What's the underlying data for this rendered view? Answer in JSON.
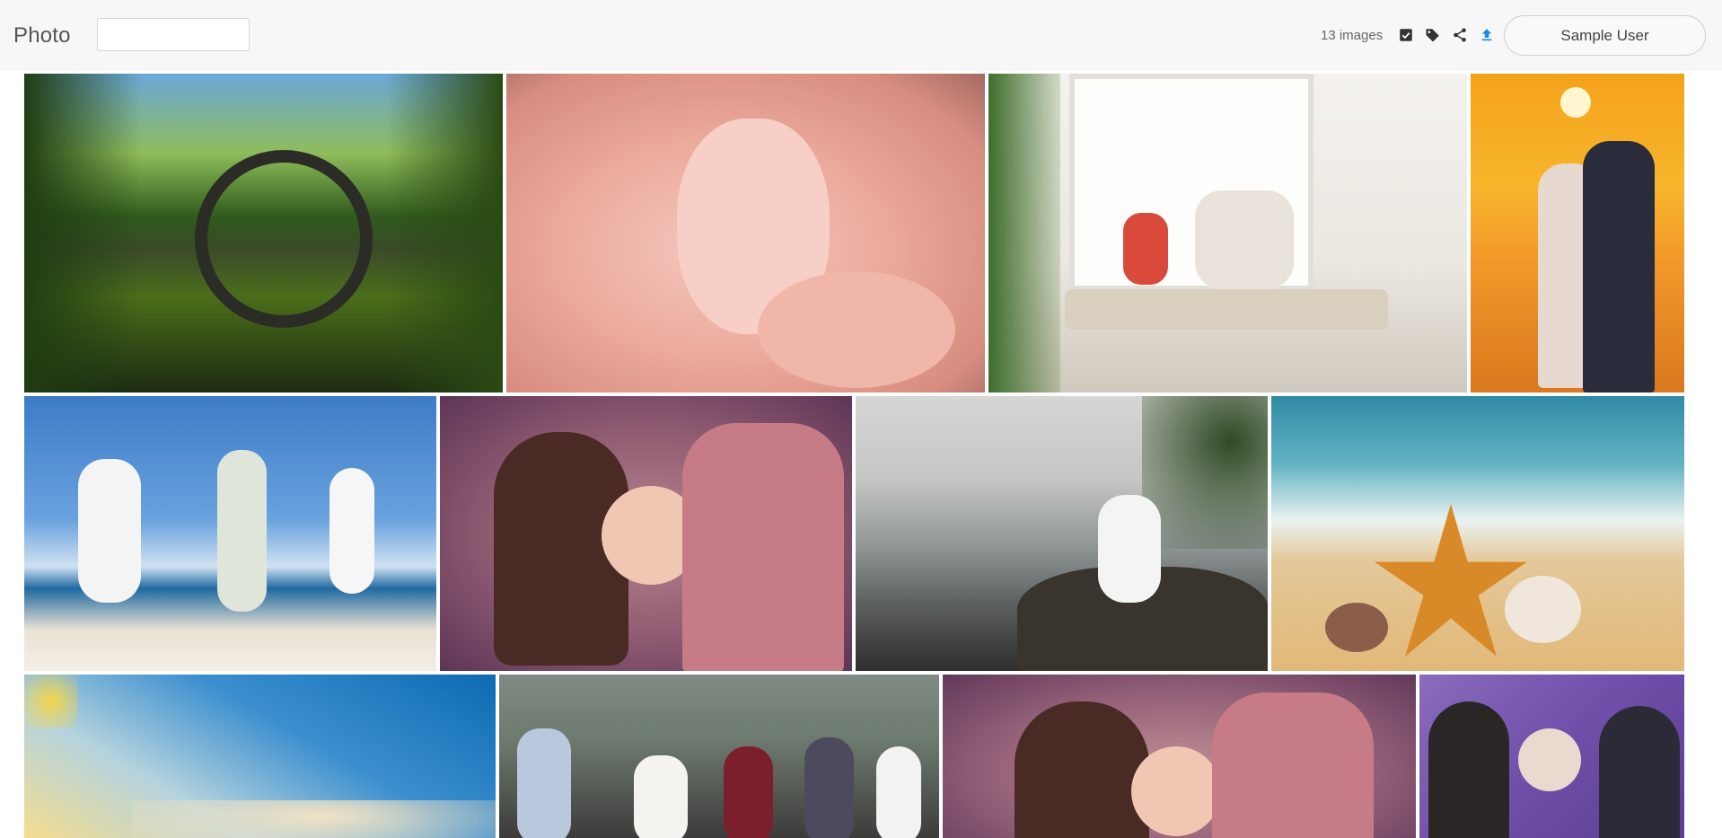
{
  "header": {
    "app_title": "Photo",
    "search": {
      "value": "",
      "placeholder": ""
    },
    "image_count": "13 images",
    "user_button": "Sample User"
  },
  "toolbar": {
    "icons": [
      "checkbox-icon",
      "tag-icon",
      "share-icon",
      "upload-icon"
    ],
    "upload_accent": "#1e88e5"
  },
  "gallery": {
    "images": [
      {
        "subject": "stone arch bridge reflected in lake"
      },
      {
        "subject": "baby feet held in hand"
      },
      {
        "subject": "mother and child at window"
      },
      {
        "subject": "couple kissing at sunset"
      },
      {
        "subject": "three friends jumping on beach"
      },
      {
        "subject": "parents kissing baby"
      },
      {
        "subject": "family sitting on seaside rocks"
      },
      {
        "subject": "starfish and shells on beach"
      },
      {
        "subject": "sunset sky over beach"
      },
      {
        "subject": "large family group outdoors"
      },
      {
        "subject": "parents kissing baby"
      },
      {
        "subject": "three generations of women"
      }
    ]
  }
}
